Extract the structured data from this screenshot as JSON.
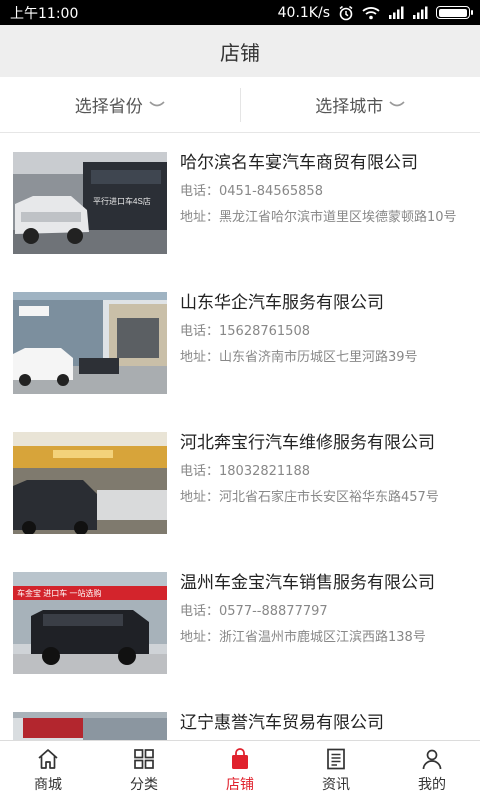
{
  "status_bar": {
    "time": "上午11:00",
    "speed": "40.1K/s"
  },
  "header": {
    "title": "店铺"
  },
  "filters": {
    "province": "选择省份",
    "city": "选择城市"
  },
  "labels": {
    "phone": "电话：",
    "address": "地址："
  },
  "stores": [
    {
      "name": "哈尔滨名车宴汽车商贸有限公司",
      "phone": "0451-84565858",
      "address": "黑龙江省哈尔滨市道里区埃德蒙顿路10号"
    },
    {
      "name": "山东华企汽车服务有限公司",
      "phone": "15628761508",
      "address": "山东省济南市历城区七里河路39号"
    },
    {
      "name": "河北奔宝行汽车维修服务有限公司",
      "phone": "18032821188",
      "address": "河北省石家庄市长安区裕华东路457号"
    },
    {
      "name": "温州车金宝汽车销售服务有限公司",
      "phone": "0577--88877797",
      "address": "浙江省温州市鹿城区江滨西路138号"
    },
    {
      "name": "辽宁惠誉汽车贸易有限公司"
    }
  ],
  "thumb_text": {
    "store_1_sign": "平行进口车4S店",
    "store_4_sign": "车金宝 进口车 一站选购"
  },
  "tabs": [
    {
      "label": "商城",
      "icon": "home-icon"
    },
    {
      "label": "分类",
      "icon": "grid-icon"
    },
    {
      "label": "店铺",
      "icon": "shop-bag-icon"
    },
    {
      "label": "资讯",
      "icon": "news-icon"
    },
    {
      "label": "我的",
      "icon": "person-icon"
    }
  ],
  "colors": {
    "accent": "#e0222d",
    "title_bar": "#eeeeee"
  }
}
